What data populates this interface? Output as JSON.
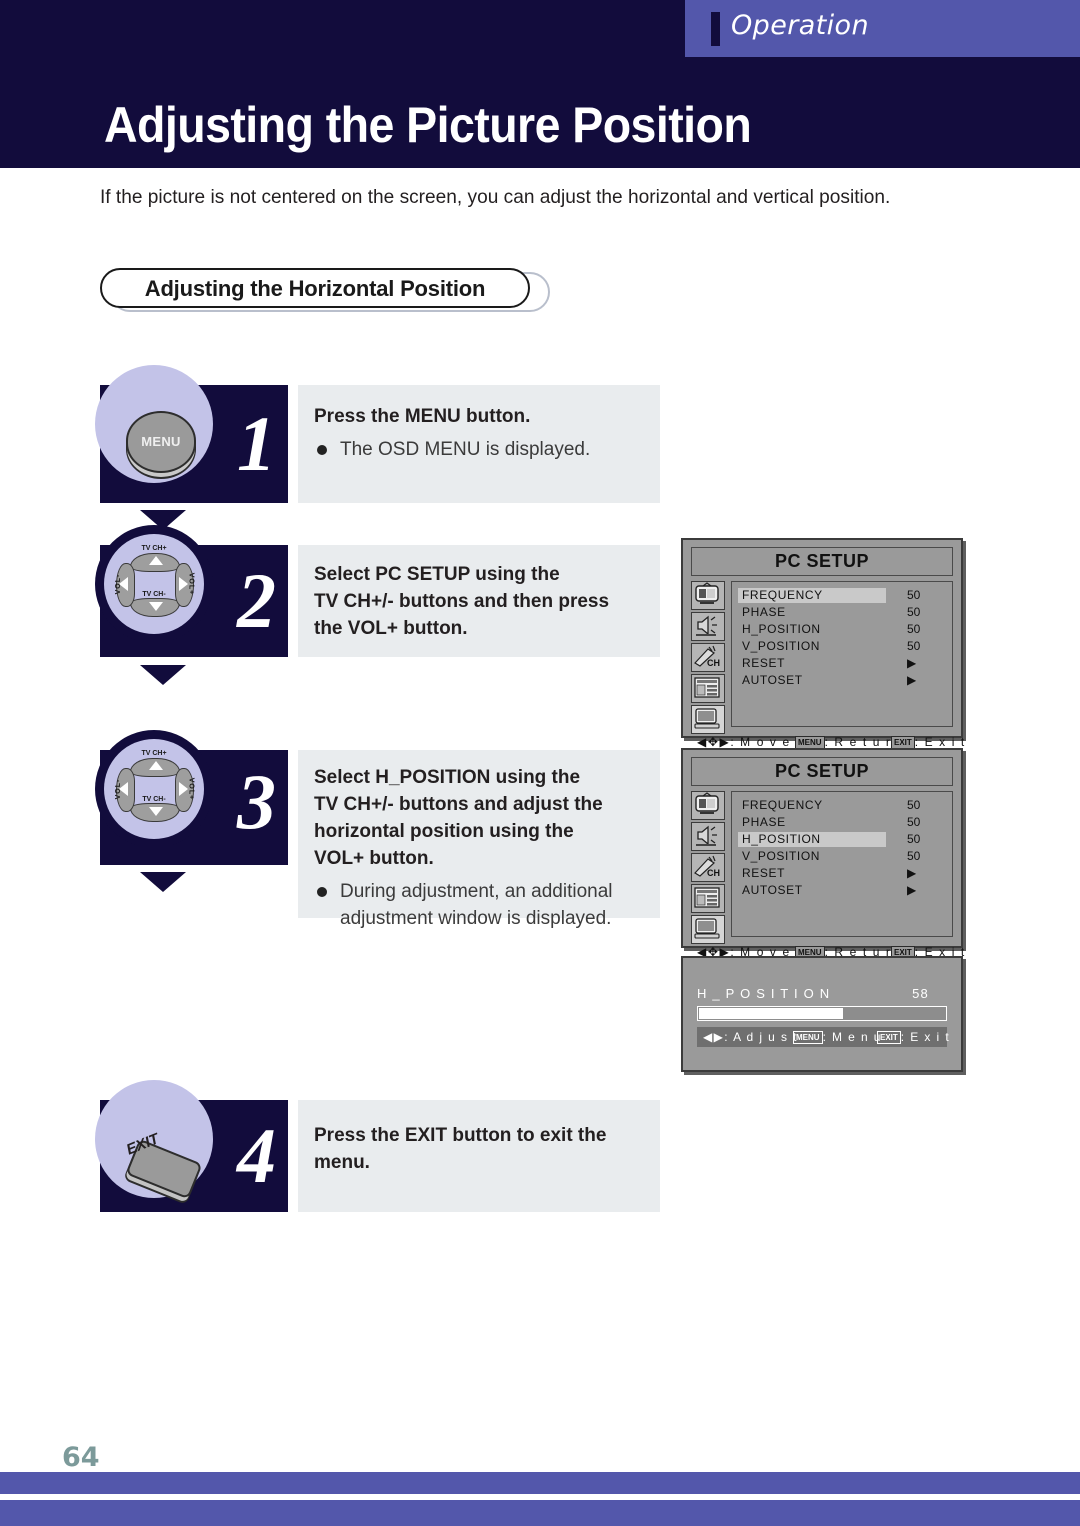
{
  "header": {
    "tab_label": "Operation",
    "title": "Adjusting the Picture Position",
    "band_color": "#120c3c",
    "tab_color": "#5357ab"
  },
  "intro": {
    "text": "If the picture is not centered on the screen, you can adjust the horizontal and vertical position."
  },
  "section": {
    "title": "Adjusting the Horizontal Position"
  },
  "steps": [
    {
      "number": "1",
      "button_label": "MENU",
      "heading": "Press the MENU button.",
      "bullets": [
        "The OSD MENU is displayed."
      ]
    },
    {
      "number": "2",
      "heading": "Select PC SETUP using the TV CH+/- buttons and then press the VOL+ button.",
      "heading_lines": [
        "Select PC SETUP using the",
        "TV CH+/- buttons and then press",
        "the VOL+ button."
      ],
      "bullets": []
    },
    {
      "number": "3",
      "heading": "Select H_POSITION using the TV CH+/- buttons and adjust the horizontal position using the VOL+ button.",
      "heading_lines": [
        "Select H_POSITION using the",
        "TV CH+/- buttons and adjust the",
        "horizontal position using the",
        "VOL+ button."
      ],
      "bullets": [
        "During adjustment, an additional",
        "adjustment window is displayed."
      ]
    },
    {
      "number": "4",
      "button_label": "EXIT",
      "heading": "Press the EXIT button to exit the menu.",
      "heading_lines": [
        "Press the EXIT button to exit the",
        "menu."
      ],
      "bullets": []
    }
  ],
  "navpad": {
    "up_label": "TV CH+",
    "down_label": "TV CH-",
    "left_label": "VOL-",
    "right_label": "VOL+"
  },
  "osd_menus": [
    {
      "title": "PC SETUP",
      "highlighted_row": 0,
      "rows": [
        {
          "name": "FREQUENCY",
          "value": "50",
          "type": "value"
        },
        {
          "name": "PHASE",
          "value": "50",
          "type": "value"
        },
        {
          "name": "H_POSITION",
          "value": "50",
          "type": "value"
        },
        {
          "name": "V_POSITION",
          "value": "50",
          "type": "value"
        },
        {
          "name": "RESET",
          "value": "▶",
          "type": "arrow"
        },
        {
          "name": "AUTOSET",
          "value": "▶",
          "type": "arrow"
        }
      ],
      "icons": [
        "tv-icon",
        "speaker-icon",
        "channel-icon",
        "function-icon",
        "pc-icon"
      ],
      "selected_icon": 4,
      "footer": {
        "move_keys": "◀✥▶",
        "move_label": ": M o v e",
        "return_key": "MENU",
        "return_label": ": R e t u r n",
        "exit_key": "EXIT",
        "exit_label": ": E x i t"
      }
    },
    {
      "title": "PC SETUP",
      "highlighted_row": 2,
      "rows": [
        {
          "name": "FREQUENCY",
          "value": "50",
          "type": "value"
        },
        {
          "name": "PHASE",
          "value": "50",
          "type": "value"
        },
        {
          "name": "H_POSITION",
          "value": "50",
          "type": "value"
        },
        {
          "name": "V_POSITION",
          "value": "50",
          "type": "value"
        },
        {
          "name": "RESET",
          "value": "▶",
          "type": "arrow"
        },
        {
          "name": "AUTOSET",
          "value": "▶",
          "type": "arrow"
        }
      ],
      "icons": [
        "tv-icon",
        "speaker-icon",
        "channel-icon",
        "function-icon",
        "pc-icon"
      ],
      "selected_icon": 4,
      "footer": {
        "move_keys": "◀✥▶",
        "move_label": ": M o v e",
        "return_key": "MENU",
        "return_label": ": R e t u r n",
        "exit_key": "EXIT",
        "exit_label": ": E x i t"
      }
    }
  ],
  "adjust_window": {
    "label": "H _ P O S I T I O N",
    "value": "58",
    "percent": 58,
    "footer": {
      "adjust_keys": "◀▶",
      "adjust_label": ": A d j u s t",
      "menu_key": "MENU",
      "menu_label": ": M e n u",
      "exit_key": "EXIT",
      "exit_label": ": E x i t"
    }
  },
  "footer": {
    "page_number": "64"
  }
}
